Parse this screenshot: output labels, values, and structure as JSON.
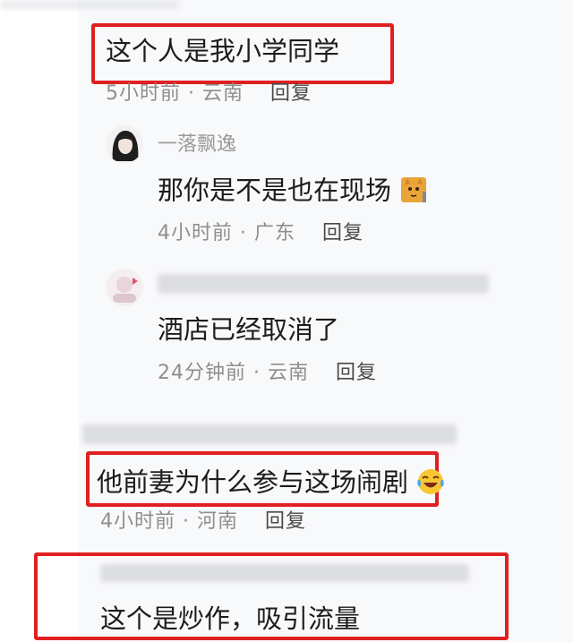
{
  "comments": [
    {
      "text": "这个人是我小学同学",
      "time": "5小时前",
      "location": "云南",
      "reply_label": "回复",
      "replies": [
        {
          "username": "一落飘逸",
          "text": "那你是不是也在现场",
          "emoji_icon": "cat-emoji-icon",
          "time": "4小时前",
          "location": "广东",
          "reply_label": "回复"
        },
        {
          "username": "",
          "text": "酒店已经取消了",
          "time": "24分钟前",
          "location": "云南",
          "reply_label": "回复"
        }
      ]
    },
    {
      "text": "他前妻为什么参与这场闹剧",
      "emoji_icon": "laughing-tears-emoji-icon",
      "time": "4小时前",
      "location": "河南",
      "reply_label": "回复"
    },
    {
      "text": "这个是炒作，吸引流量"
    }
  ],
  "colors": {
    "highlight_red": "#e02020",
    "meta_gray": "#8e8e8e",
    "panel_bg": "#f8f9fb"
  }
}
